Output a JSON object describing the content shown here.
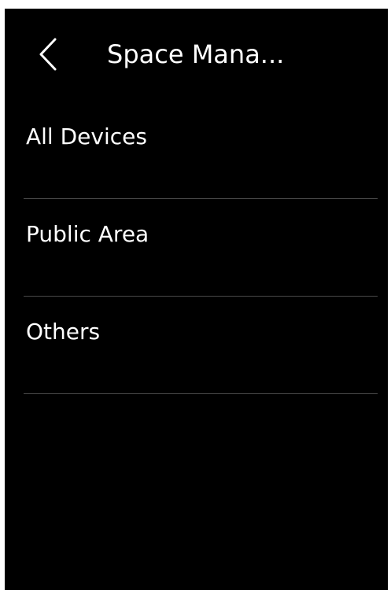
{
  "header": {
    "title": "Space Mana...",
    "back_icon": "chevron-left-icon"
  },
  "menu": {
    "items": [
      {
        "label": "All Devices"
      },
      {
        "label": "Public Area"
      },
      {
        "label": "Others"
      }
    ]
  },
  "colors": {
    "background": "#000000",
    "text": "#ffffff",
    "divider": "#4a4a4a"
  }
}
